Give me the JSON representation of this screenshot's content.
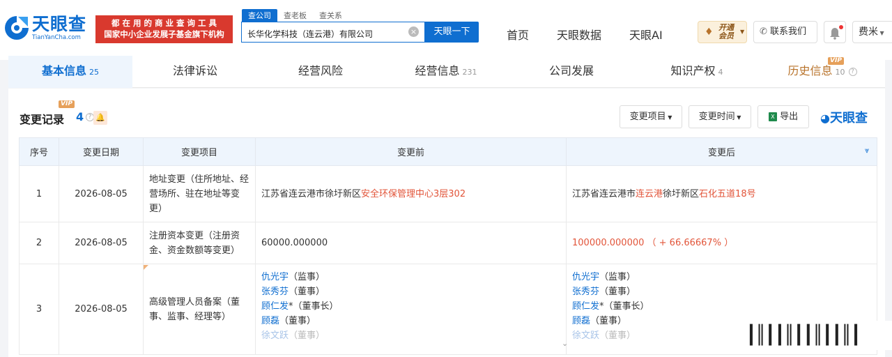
{
  "header": {
    "logo_cn": "天眼查",
    "logo_en": "TianYanCha.com",
    "slogan_line1": "都 在 用 的 商 业 查 询 工 具",
    "slogan_line2": "国家中小企业发展子基金旗下机构",
    "search_tabs": [
      "查公司",
      "查老板",
      "查关系"
    ],
    "search_value": "长华化学科技（连云港）有限公司",
    "search_button": "天眼一下",
    "nav": [
      "首页",
      "天眼数据",
      "天眼AI"
    ],
    "vip_line1": "开通",
    "vip_line2": "会员",
    "contact": "联系我们",
    "user": "费米"
  },
  "tabs": [
    {
      "label": "基本信息",
      "count": "25"
    },
    {
      "label": "法律诉讼",
      "count": ""
    },
    {
      "label": "经营风险",
      "count": ""
    },
    {
      "label": "经营信息",
      "count": "231"
    },
    {
      "label": "公司发展",
      "count": ""
    },
    {
      "label": "知识产权",
      "count": "4"
    },
    {
      "label": "历史信息",
      "count": "10",
      "vip": "VIP"
    }
  ],
  "section": {
    "title": "变更记录",
    "vip": "VIP",
    "count": "4",
    "buttons": [
      "变更项目",
      "变更时间",
      "导出"
    ],
    "brand": "天眼查"
  },
  "table": {
    "headers": [
      "序号",
      "变更日期",
      "变更项目",
      "变更前",
      "变更后"
    ],
    "rows": [
      {
        "no": "1",
        "date": "2026-08-05",
        "item": "地址变更（住所地址、经营场所、驻在地址等变更）",
        "before_plain": "江苏省连云港市徐圩新区",
        "before_hl": "安全环保管理中心3层302",
        "after_p1": "江苏省连云港市",
        "after_h1": "连云港",
        "after_p2": "徐圩新区",
        "after_h2": "石化五道18号"
      },
      {
        "no": "2",
        "date": "2026-08-05",
        "item": "注册资本变更（注册资金、资金数额等变更）",
        "before": "60000.000000",
        "after": "100000.000000 （ + 66.66667% ）"
      },
      {
        "no": "3",
        "date": "2026-08-05",
        "item": "高级管理人员备案（董事、监事、经理等）",
        "people": [
          {
            "name": "仇光宇",
            "role": "（监事）"
          },
          {
            "name": "张秀芬",
            "role": "（董事）"
          },
          {
            "name": "顾仁发",
            "role": "*（董事长）"
          },
          {
            "name": "顾磊",
            "role": "（董事）"
          },
          {
            "name": "徐文跃",
            "role": "（董事）"
          }
        ]
      }
    ]
  },
  "watermark": "┃║┃┃║┃┃║┃┃║┃"
}
